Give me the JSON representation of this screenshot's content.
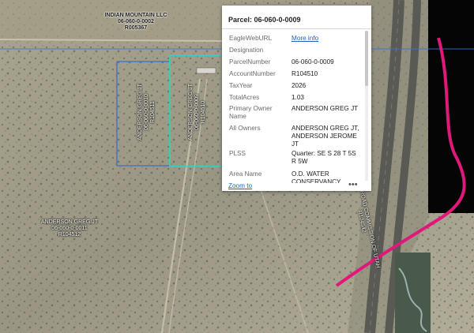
{
  "map": {
    "labels": {
      "top_parcel": [
        "INDIAN MOUNTAIN LLC",
        "06-060-0-0002",
        "R005367"
      ],
      "left_parcel": [
        "ANDERSON GREG JT",
        "06-060-0-0011",
        "R104512"
      ],
      "vertical_parcel_1": [
        "ANDERSON GREG JT",
        "06-060-0-0010",
        "R104511"
      ],
      "vertical_parcel_2": [
        "ANDERSON GREG JT",
        "06-060-0-0009",
        "R104510"
      ],
      "road": [
        "STATE ROAD COMMISSION OF UTAH",
        "R104542"
      ]
    },
    "colors": {
      "selected_outline": "#20d8d0",
      "parcel_outline": "#3a70c8",
      "highlight_line": "#e0187a"
    }
  },
  "popup": {
    "title": "Parcel: 06-060-0-0009",
    "fields": [
      {
        "key": "EagleWebURL",
        "value": "More info",
        "link": true
      },
      {
        "key": "Designation",
        "value": ""
      },
      {
        "key": "ParcelNumber",
        "value": "06-060-0-0009"
      },
      {
        "key": "AccountNumber",
        "value": "R104510"
      },
      {
        "key": "TaxYear",
        "value": "2026"
      },
      {
        "key": "TotalAcres",
        "value": "1.03"
      },
      {
        "key": "Primary Owner Name",
        "value": "ANDERSON GREG JT"
      },
      {
        "key": "All Owners",
        "value": "ANDERSON GREG JT, ANDERSON JEROME JT"
      },
      {
        "key": "PLSS",
        "value": "Quarter: SE S 28 T 5S R 5W"
      },
      {
        "key": "Area Name",
        "value": "O.D. WATER CONSERVANCY"
      }
    ],
    "footer": {
      "zoom_label": "Zoom to",
      "more_icon": "ellipsis-icon"
    },
    "controls": {
      "maximize_icon": "maximize-icon",
      "close_icon": "close-icon",
      "close_glyph": "✕"
    }
  }
}
